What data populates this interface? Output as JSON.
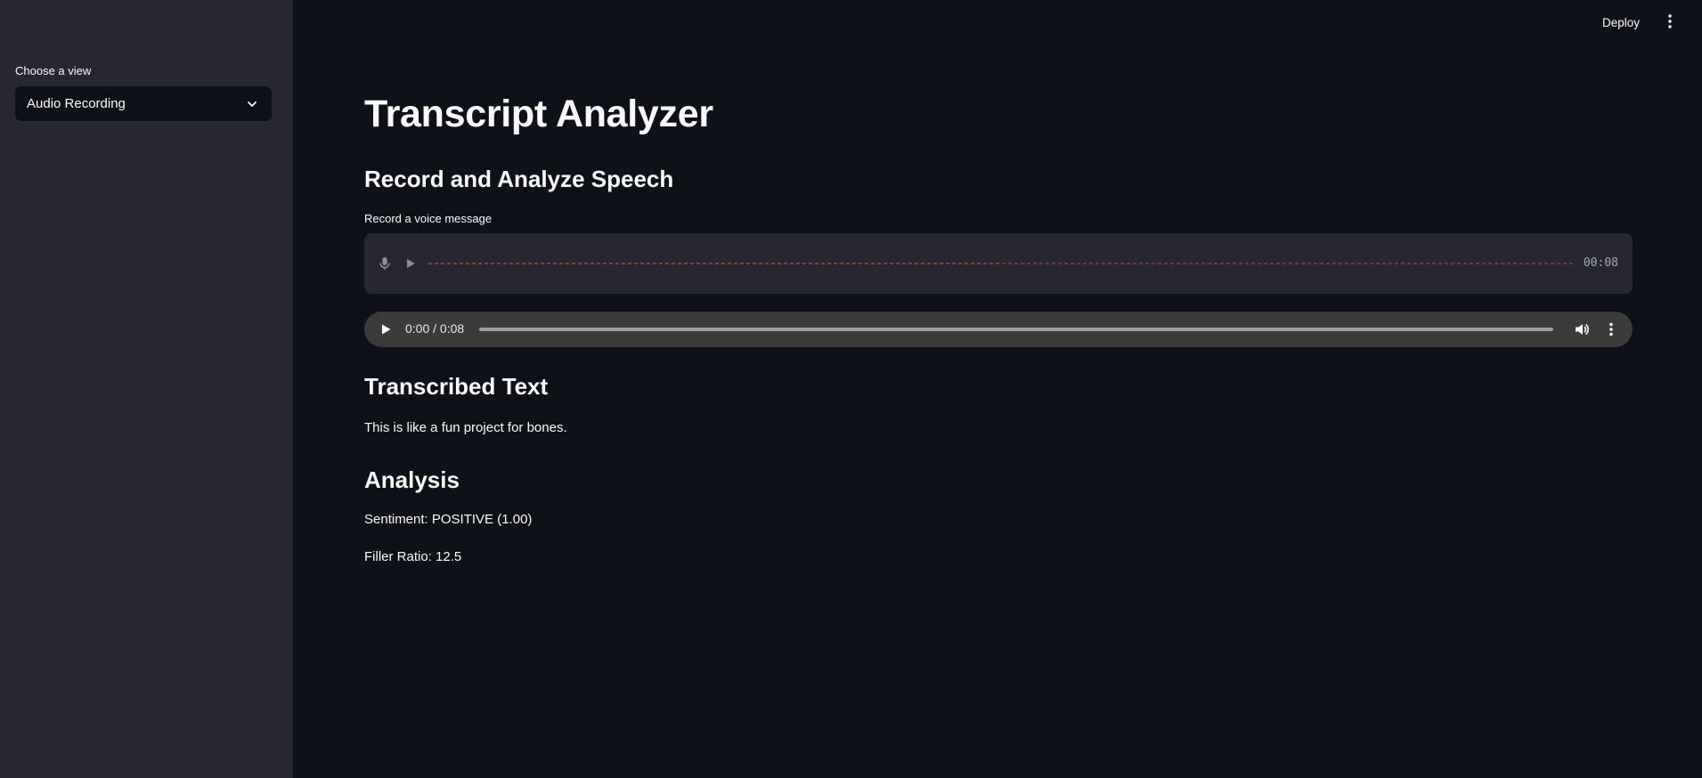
{
  "sidebar": {
    "select_label": "Choose a view",
    "selected_value": "Audio Recording"
  },
  "header": {
    "deploy_label": "Deploy"
  },
  "main": {
    "title": "Transcript Analyzer",
    "subtitle": "Record and Analyze Speech",
    "recorder": {
      "label": "Record a voice message",
      "duration": "00:08",
      "waveform_color": "#ff4b4b"
    },
    "player": {
      "time": "0:00 / 0:08",
      "progress": 0
    },
    "transcription": {
      "heading": "Transcribed Text",
      "text": "This is like a fun project for bones."
    },
    "analysis": {
      "heading": "Analysis",
      "sentiment": "Sentiment: POSITIVE (1.00)",
      "filler_ratio": "Filler Ratio: 12.5"
    }
  },
  "icons": [
    "chevron-down-icon",
    "kebab-menu-icon",
    "microphone-icon",
    "play-icon",
    "volume-icon",
    "more-options-icon"
  ]
}
